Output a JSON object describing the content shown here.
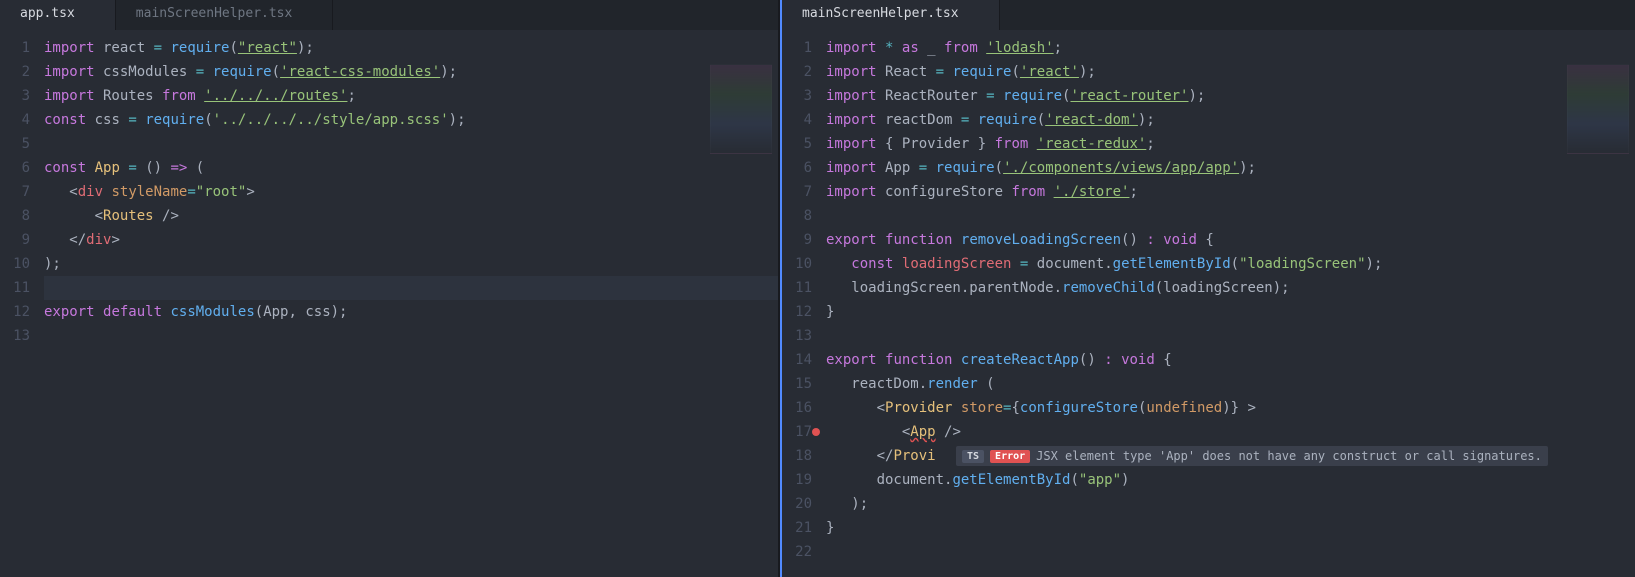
{
  "panes": [
    {
      "tabs": [
        {
          "label": "app.tsx",
          "active": true
        },
        {
          "label": "mainScreenHelper.tsx",
          "active": false
        }
      ],
      "lines": [
        [
          [
            "kw",
            "import"
          ],
          [
            "id",
            " react "
          ],
          [
            "eq",
            "="
          ],
          [
            "id",
            " "
          ],
          [
            "fn",
            "require"
          ],
          [
            "id",
            "("
          ],
          [
            "strU",
            "\"react\""
          ],
          [
            "id",
            ");"
          ]
        ],
        [
          [
            "kw",
            "import"
          ],
          [
            "id",
            " cssModules "
          ],
          [
            "eq",
            "="
          ],
          [
            "id",
            " "
          ],
          [
            "fn",
            "require"
          ],
          [
            "id",
            "("
          ],
          [
            "strU",
            "'react-css-modules'"
          ],
          [
            "id",
            ");"
          ]
        ],
        [
          [
            "kw",
            "import"
          ],
          [
            "id",
            " Routes "
          ],
          [
            "kw",
            "from"
          ],
          [
            "id",
            " "
          ],
          [
            "strU",
            "'../../../routes'"
          ],
          [
            "id",
            ";"
          ]
        ],
        [
          [
            "kw",
            "const"
          ],
          [
            "id",
            " css "
          ],
          [
            "eq",
            "="
          ],
          [
            "id",
            " "
          ],
          [
            "fn",
            "require"
          ],
          [
            "id",
            "("
          ],
          [
            "str",
            "'../../../../style/app.scss'"
          ],
          [
            "id",
            ");"
          ]
        ],
        [],
        [
          [
            "kw",
            "const"
          ],
          [
            "id",
            " "
          ],
          [
            "def",
            "App"
          ],
          [
            "id",
            " "
          ],
          [
            "eq",
            "="
          ],
          [
            "id",
            " () "
          ],
          [
            "kw",
            "=>"
          ],
          [
            "id",
            " ("
          ]
        ],
        [
          [
            "id",
            "   "
          ],
          [
            "grey",
            "<"
          ],
          [
            "tag",
            "div"
          ],
          [
            "id",
            " "
          ],
          [
            "attr",
            "styleName"
          ],
          [
            "eq",
            "="
          ],
          [
            "str",
            "\"root\""
          ],
          [
            "grey",
            ">"
          ]
        ],
        [
          [
            "id",
            "      "
          ],
          [
            "grey",
            "<"
          ],
          [
            "def",
            "Routes"
          ],
          [
            "id",
            " "
          ],
          [
            "grey",
            "/>"
          ]
        ],
        [
          [
            "id",
            "   "
          ],
          [
            "grey",
            "</"
          ],
          [
            "tag",
            "div"
          ],
          [
            "grey",
            ">"
          ]
        ],
        [
          [
            "id",
            ");"
          ]
        ],
        [],
        [
          [
            "kw",
            "export"
          ],
          [
            "id",
            " "
          ],
          [
            "kw",
            "default"
          ],
          [
            "id",
            " "
          ],
          [
            "fn",
            "cssModules"
          ],
          [
            "id",
            "(App, css);"
          ]
        ],
        []
      ],
      "highlight": 11
    },
    {
      "tabs": [
        {
          "label": "mainScreenHelper.tsx",
          "active": true
        }
      ],
      "lines": [
        [
          [
            "kw",
            "import"
          ],
          [
            "id",
            " "
          ],
          [
            "eq",
            "*"
          ],
          [
            "id",
            " "
          ],
          [
            "kw",
            "as"
          ],
          [
            "id",
            " _ "
          ],
          [
            "kw",
            "from"
          ],
          [
            "id",
            " "
          ],
          [
            "strU",
            "'lodash'"
          ],
          [
            "id",
            ";"
          ]
        ],
        [
          [
            "kw",
            "import"
          ],
          [
            "id",
            " React "
          ],
          [
            "eq",
            "="
          ],
          [
            "id",
            " "
          ],
          [
            "fn",
            "require"
          ],
          [
            "id",
            "("
          ],
          [
            "strU",
            "'react'"
          ],
          [
            "id",
            ");"
          ]
        ],
        [
          [
            "kw",
            "import"
          ],
          [
            "id",
            " ReactRouter "
          ],
          [
            "eq",
            "="
          ],
          [
            "id",
            " "
          ],
          [
            "fn",
            "require"
          ],
          [
            "id",
            "("
          ],
          [
            "strU",
            "'react-router'"
          ],
          [
            "id",
            ");"
          ]
        ],
        [
          [
            "kw",
            "import"
          ],
          [
            "id",
            " reactDom "
          ],
          [
            "eq",
            "="
          ],
          [
            "id",
            " "
          ],
          [
            "fn",
            "require"
          ],
          [
            "id",
            "("
          ],
          [
            "strU",
            "'react-dom'"
          ],
          [
            "id",
            ");"
          ]
        ],
        [
          [
            "kw",
            "import"
          ],
          [
            "id",
            " { Provider } "
          ],
          [
            "kw",
            "from"
          ],
          [
            "id",
            " "
          ],
          [
            "strU",
            "'react-redux'"
          ],
          [
            "id",
            ";"
          ]
        ],
        [
          [
            "kw",
            "import"
          ],
          [
            "id",
            " App "
          ],
          [
            "eq",
            "="
          ],
          [
            "id",
            " "
          ],
          [
            "fn",
            "require"
          ],
          [
            "id",
            "("
          ],
          [
            "strU",
            "'./components/views/app/app'"
          ],
          [
            "id",
            ");"
          ]
        ],
        [
          [
            "kw",
            "import"
          ],
          [
            "id",
            " configureStore "
          ],
          [
            "kw",
            "from"
          ],
          [
            "id",
            " "
          ],
          [
            "strU",
            "'./store'"
          ],
          [
            "id",
            ";"
          ]
        ],
        [],
        [
          [
            "kw",
            "export"
          ],
          [
            "id",
            " "
          ],
          [
            "kw",
            "function"
          ],
          [
            "id",
            " "
          ],
          [
            "fn",
            "removeLoadingScreen"
          ],
          [
            "id",
            "() "
          ],
          [
            "kw",
            ":"
          ],
          [
            "id",
            " "
          ],
          [
            "kw",
            "void"
          ],
          [
            "id",
            " {"
          ]
        ],
        [
          [
            "id",
            "   "
          ],
          [
            "kw",
            "const"
          ],
          [
            "id",
            " "
          ],
          [
            "var",
            "loadingScreen"
          ],
          [
            "id",
            " "
          ],
          [
            "eq",
            "="
          ],
          [
            "id",
            " document."
          ],
          [
            "fn",
            "getElementById"
          ],
          [
            "id",
            "("
          ],
          [
            "str",
            "\"loadingScreen\""
          ],
          [
            "id",
            ");"
          ]
        ],
        [
          [
            "id",
            "   loadingScreen.parentNode."
          ],
          [
            "fn",
            "removeChild"
          ],
          [
            "id",
            "(loadingScreen);"
          ]
        ],
        [
          [
            "id",
            "}"
          ]
        ],
        [],
        [
          [
            "kw",
            "export"
          ],
          [
            "id",
            " "
          ],
          [
            "kw",
            "function"
          ],
          [
            "id",
            " "
          ],
          [
            "fn",
            "createReactApp"
          ],
          [
            "id",
            "() "
          ],
          [
            "kw",
            ":"
          ],
          [
            "id",
            " "
          ],
          [
            "kw",
            "void"
          ],
          [
            "id",
            " {"
          ]
        ],
        [
          [
            "id",
            "   reactDom."
          ],
          [
            "fn",
            "render"
          ],
          [
            "id",
            " ("
          ]
        ],
        [
          [
            "id",
            "      "
          ],
          [
            "grey",
            "<"
          ],
          [
            "def",
            "Provider"
          ],
          [
            "id",
            " "
          ],
          [
            "attr",
            "store"
          ],
          [
            "eq",
            "="
          ],
          [
            "id",
            "{"
          ],
          [
            "fn",
            "configureStore"
          ],
          [
            "id",
            "("
          ],
          [
            "num",
            "undefined"
          ],
          [
            "id",
            ")} "
          ],
          [
            "grey",
            ">"
          ]
        ],
        [
          [
            "id",
            "         "
          ],
          [
            "grey",
            "<"
          ],
          [
            "def",
            "App"
          ],
          [
            "id",
            " "
          ],
          [
            "grey",
            "/>"
          ]
        ],
        [
          [
            "id",
            "      "
          ],
          [
            "grey",
            "</"
          ],
          [
            "def",
            "Provi"
          ]
        ],
        [
          [
            "id",
            "      document."
          ],
          [
            "fn",
            "getElementById"
          ],
          [
            "id",
            "("
          ],
          [
            "str",
            "\"app\""
          ],
          [
            "id",
            ")"
          ]
        ],
        [
          [
            "id",
            "   );"
          ]
        ],
        [
          [
            "id",
            "}"
          ]
        ],
        []
      ],
      "errorLine": 17,
      "tooltip": {
        "line": 18,
        "badges": [
          "TS",
          "Error"
        ],
        "text": "JSX element type 'App' does not have any construct or call signatures."
      }
    }
  ]
}
